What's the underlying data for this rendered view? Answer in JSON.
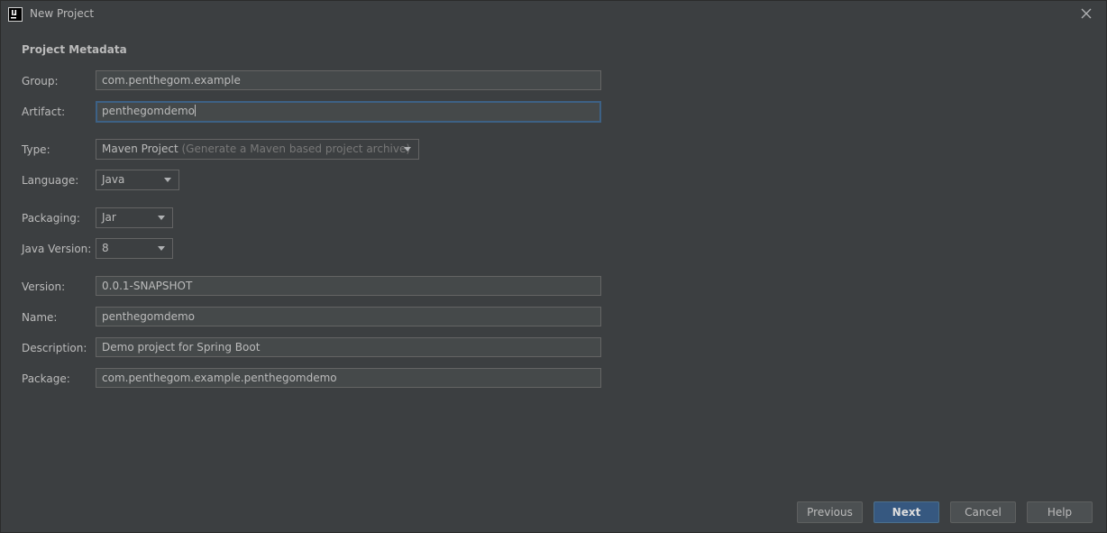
{
  "window": {
    "title": "New Project",
    "app_icon": "intellij-icon",
    "close_icon": "close-icon"
  },
  "section": {
    "title": "Project Metadata"
  },
  "fields": {
    "group": {
      "label": "Group:",
      "value": "com.penthegom.example"
    },
    "artifact": {
      "label": "Artifact:",
      "value": "penthegomdemo"
    },
    "type": {
      "label": "Type:",
      "value": "Maven Project",
      "hint": "(Generate a Maven based project archive)"
    },
    "language": {
      "label": "Language:",
      "value": "Java"
    },
    "packaging": {
      "label": "Packaging:",
      "value": "Jar"
    },
    "java_version": {
      "label": "Java Version:",
      "value": "8"
    },
    "version": {
      "label": "Version:",
      "value": "0.0.1-SNAPSHOT"
    },
    "name": {
      "label": "Name:",
      "value": "penthegomdemo"
    },
    "description": {
      "label": "Description:",
      "value": "Demo project for Spring Boot"
    },
    "package": {
      "label": "Package:",
      "value": "com.penthegom.example.penthegomdemo"
    }
  },
  "buttons": {
    "previous": "Previous",
    "next": "Next",
    "cancel": "Cancel",
    "help": "Help"
  },
  "colors": {
    "background": "#3c3f41",
    "field_background": "#45494a",
    "focus_border": "#3d6185",
    "default_button": "#365880",
    "text": "#bbbbbb"
  }
}
